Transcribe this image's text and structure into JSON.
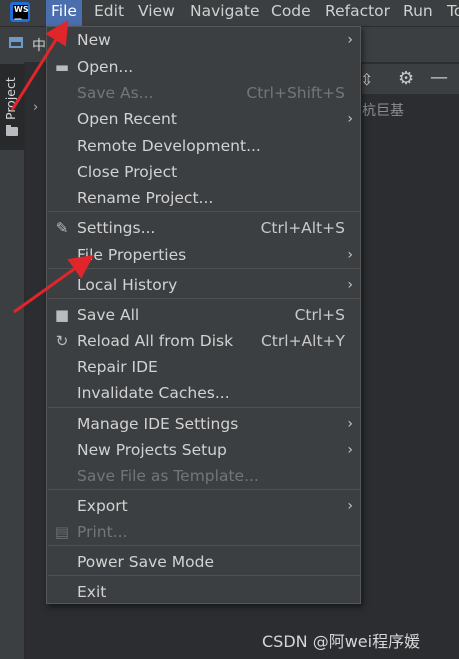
{
  "menubar": {
    "items": [
      "File",
      "Edit",
      "View",
      "Navigate",
      "Code",
      "Refactor",
      "Run",
      "To"
    ],
    "active": "File",
    "logo_text": [
      "WS",
      "—"
    ]
  },
  "toolbar": {
    "breadcrumb": "中"
  },
  "sidebar": {
    "project_tab": "Project"
  },
  "project_panel": {
    "tail_text": "杭巨基"
  },
  "file_menu": {
    "items": [
      {
        "label": "New",
        "shortcut": "",
        "submenu": true,
        "disabled": false,
        "icon": ""
      },
      {
        "label": "Open...",
        "shortcut": "",
        "submenu": false,
        "disabled": false,
        "icon": "folder-open-icon"
      },
      {
        "label": "Save As...",
        "shortcut": "Ctrl+Shift+S",
        "submenu": false,
        "disabled": true,
        "icon": ""
      },
      {
        "label": "Open Recent",
        "shortcut": "",
        "submenu": true,
        "disabled": false,
        "icon": ""
      },
      {
        "label": "Remote Development...",
        "shortcut": "",
        "submenu": false,
        "disabled": false,
        "icon": ""
      },
      {
        "label": "Close Project",
        "shortcut": "",
        "submenu": false,
        "disabled": false,
        "icon": ""
      },
      {
        "label": "Rename Project...",
        "shortcut": "",
        "submenu": false,
        "disabled": false,
        "icon": ""
      },
      {
        "label": "Settings...",
        "shortcut": "Ctrl+Alt+S",
        "submenu": false,
        "disabled": false,
        "icon": "wrench-icon"
      },
      {
        "label": "File Properties",
        "shortcut": "",
        "submenu": true,
        "disabled": false,
        "icon": ""
      },
      {
        "label": "Local History",
        "shortcut": "",
        "submenu": true,
        "disabled": false,
        "icon": ""
      },
      {
        "label": "Save All",
        "shortcut": "Ctrl+S",
        "submenu": false,
        "disabled": false,
        "icon": "save-icon"
      },
      {
        "label": "Reload All from Disk",
        "shortcut": "Ctrl+Alt+Y",
        "submenu": false,
        "disabled": false,
        "icon": "reload-icon"
      },
      {
        "label": "Repair IDE",
        "shortcut": "",
        "submenu": false,
        "disabled": false,
        "icon": ""
      },
      {
        "label": "Invalidate Caches...",
        "shortcut": "",
        "submenu": false,
        "disabled": false,
        "icon": ""
      },
      {
        "label": "Manage IDE Settings",
        "shortcut": "",
        "submenu": true,
        "disabled": false,
        "icon": ""
      },
      {
        "label": "New Projects Setup",
        "shortcut": "",
        "submenu": true,
        "disabled": false,
        "icon": ""
      },
      {
        "label": "Save File as Template...",
        "shortcut": "",
        "submenu": false,
        "disabled": true,
        "icon": ""
      },
      {
        "label": "Export",
        "shortcut": "",
        "submenu": true,
        "disabled": false,
        "icon": ""
      },
      {
        "label": "Print...",
        "shortcut": "",
        "submenu": false,
        "disabled": true,
        "icon": "print-icon"
      },
      {
        "label": "Power Save Mode",
        "shortcut": "",
        "submenu": false,
        "disabled": false,
        "icon": ""
      },
      {
        "label": "Exit",
        "shortcut": "",
        "submenu": false,
        "disabled": false,
        "icon": ""
      }
    ]
  },
  "watermark": "CSDN @阿wei程序媛",
  "colors": {
    "menubar_bg": "#3c3f41",
    "active_menu_bg": "#4b6eaf",
    "menu_bg": "#3c3f41",
    "annotation_arrow": "#e0262b"
  }
}
